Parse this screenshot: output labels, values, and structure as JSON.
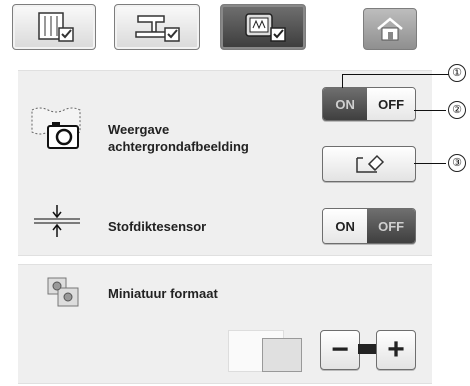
{
  "tabs": [
    {
      "name": "tab-general-settings",
      "icon": "page-settings-icon",
      "active": false
    },
    {
      "name": "tab-machine-settings",
      "icon": "sewing-machine-icon",
      "active": false
    },
    {
      "name": "tab-display-settings",
      "icon": "embroidery-frame-icon",
      "active": true
    }
  ],
  "home_icon": "home-icon",
  "settings": {
    "background_image": {
      "label": "Weergave achtergrondafbeelding",
      "icon": "camera-icon",
      "toggle": {
        "on_label": "ON",
        "off_label": "OFF",
        "state": "on"
      },
      "erase_icon": "eraser-icon"
    },
    "fabric_thickness": {
      "label": "Stofdiktesensor",
      "icon": "thickness-sensor-icon",
      "toggle": {
        "on_label": "ON",
        "off_label": "OFF",
        "state": "on"
      }
    },
    "thumbnail_size": {
      "label": "Miniatuur formaat",
      "icon": "gear-thumbnail-icon",
      "minus_label": "−",
      "plus_label": "+"
    }
  },
  "callouts": [
    "①",
    "②",
    "③"
  ]
}
